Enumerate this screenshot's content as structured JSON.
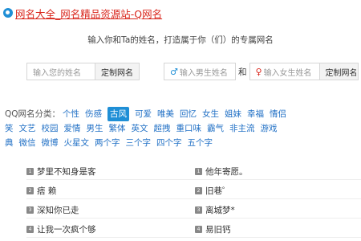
{
  "header": {
    "title": "网名大全_网名精品资源站-Q网名",
    "subtitle": "输入你和Ta的姓名，打造属于你（们）的专属网名"
  },
  "form": {
    "name_placeholder": "输入您的姓名",
    "make_label": "定制网名",
    "male_placeholder": "输入男生姓名",
    "and_text": "和",
    "female_placeholder": "输入女生姓名",
    "make_label_2": "定制网名"
  },
  "tags": {
    "label": "QQ网名分类：",
    "line1": [
      "个性",
      "伤感",
      "古风",
      "可爱",
      "唯美",
      "回忆",
      "女生",
      "姐妹",
      "幸福",
      "情侣"
    ],
    "line2": [
      "笑",
      "文艺",
      "校园",
      "爱情",
      "男生",
      "繁体",
      "英文",
      "超拽",
      "重口味",
      "霸气",
      "非主流",
      "游戏"
    ],
    "line3": [
      "典",
      "微信",
      "微博",
      "火星文",
      "两个字",
      "三个字",
      "四个字",
      "五个字"
    ],
    "active_index": 2
  },
  "names": {
    "rows": [
      [
        "梦里不知身是客",
        "他年寄愿。"
      ],
      [
        "痞 赖",
        "旧巷゜"
      ],
      [
        "深知你已走",
        "离城梦*"
      ],
      [
        "让我一次疯个够",
        "易旧钙"
      ]
    ]
  },
  "colors": {
    "accent": "#1f8fd6",
    "title_red": "#d9261c",
    "link_blue": "#1f6fc5"
  }
}
